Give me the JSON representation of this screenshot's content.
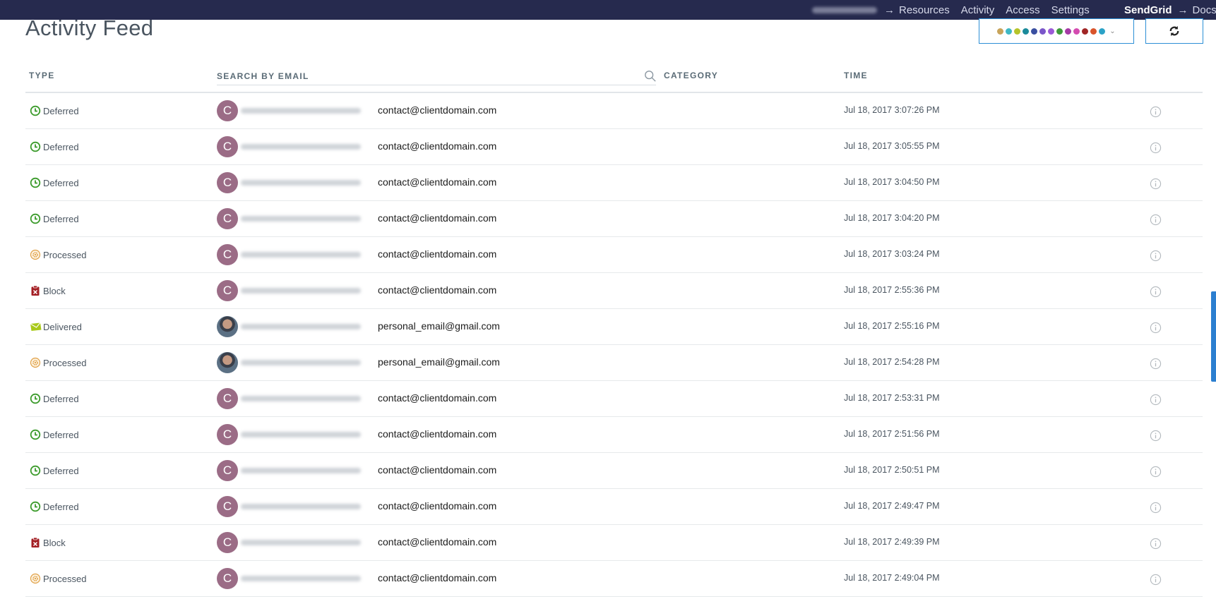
{
  "nav": {
    "arrow": "→",
    "links": [
      "Resources",
      "Activity",
      "Access",
      "Settings"
    ],
    "brand": "SendGrid",
    "docs": "Docs"
  },
  "header": {
    "title": "Activity Feed",
    "filter_colors": [
      "#c8a45a",
      "#3fb8c4",
      "#b6c42a",
      "#1b8a9a",
      "#3a4fa0",
      "#7a56c9",
      "#9b5ad6",
      "#3e9a3a",
      "#a63aa6",
      "#d44bb0",
      "#a02525",
      "#d9542b",
      "#2ba2c7"
    ],
    "filter_caret": "⌄"
  },
  "columns": {
    "type": "TYPE",
    "search_placeholder": "SEARCH BY EMAIL",
    "category": "CATEGORY",
    "time": "TIME"
  },
  "rows": [
    {
      "type": "Deferred",
      "icon": "clock-icon",
      "avatar": "C",
      "recipient": "contact@clientdomain.com",
      "time": "Jul 18, 2017 3:07:26 PM"
    },
    {
      "type": "Deferred",
      "icon": "clock-icon",
      "avatar": "C",
      "recipient": "contact@clientdomain.com",
      "time": "Jul 18, 2017 3:05:55 PM"
    },
    {
      "type": "Deferred",
      "icon": "clock-icon",
      "avatar": "C",
      "recipient": "contact@clientdomain.com",
      "time": "Jul 18, 2017 3:04:50 PM"
    },
    {
      "type": "Deferred",
      "icon": "clock-icon",
      "avatar": "C",
      "recipient": "contact@clientdomain.com",
      "time": "Jul 18, 2017 3:04:20 PM"
    },
    {
      "type": "Processed",
      "icon": "gear-icon",
      "avatar": "C",
      "recipient": "contact@clientdomain.com",
      "time": "Jul 18, 2017 3:03:24 PM"
    },
    {
      "type": "Block",
      "icon": "block-icon",
      "avatar": "C",
      "recipient": "contact@clientdomain.com",
      "time": "Jul 18, 2017 2:55:36 PM"
    },
    {
      "type": "Delivered",
      "icon": "envelope-icon",
      "avatar": "photo",
      "recipient": "personal_email@gmail.com",
      "time": "Jul 18, 2017 2:55:16 PM"
    },
    {
      "type": "Processed",
      "icon": "gear-icon",
      "avatar": "photo",
      "recipient": "personal_email@gmail.com",
      "time": "Jul 18, 2017 2:54:28 PM"
    },
    {
      "type": "Deferred",
      "icon": "clock-icon",
      "avatar": "C",
      "recipient": "contact@clientdomain.com",
      "time": "Jul 18, 2017 2:53:31 PM"
    },
    {
      "type": "Deferred",
      "icon": "clock-icon",
      "avatar": "C",
      "recipient": "contact@clientdomain.com",
      "time": "Jul 18, 2017 2:51:56 PM"
    },
    {
      "type": "Deferred",
      "icon": "clock-icon",
      "avatar": "C",
      "recipient": "contact@clientdomain.com",
      "time": "Jul 18, 2017 2:50:51 PM"
    },
    {
      "type": "Deferred",
      "icon": "clock-icon",
      "avatar": "C",
      "recipient": "contact@clientdomain.com",
      "time": "Jul 18, 2017 2:49:47 PM"
    },
    {
      "type": "Block",
      "icon": "block-icon",
      "avatar": "C",
      "recipient": "contact@clientdomain.com",
      "time": "Jul 18, 2017 2:49:39 PM"
    },
    {
      "type": "Processed",
      "icon": "gear-icon",
      "avatar": "C",
      "recipient": "contact@clientdomain.com",
      "time": "Jul 18, 2017 2:49:04 PM"
    }
  ],
  "colors": {
    "nav_bg": "#262a4e",
    "accent": "#2c8fd6",
    "avatar": "#9b6c86",
    "deferred": "#3a9a2a",
    "processed": "#e0a045",
    "block": "#a31f24",
    "delivered": "#a9c91a"
  }
}
